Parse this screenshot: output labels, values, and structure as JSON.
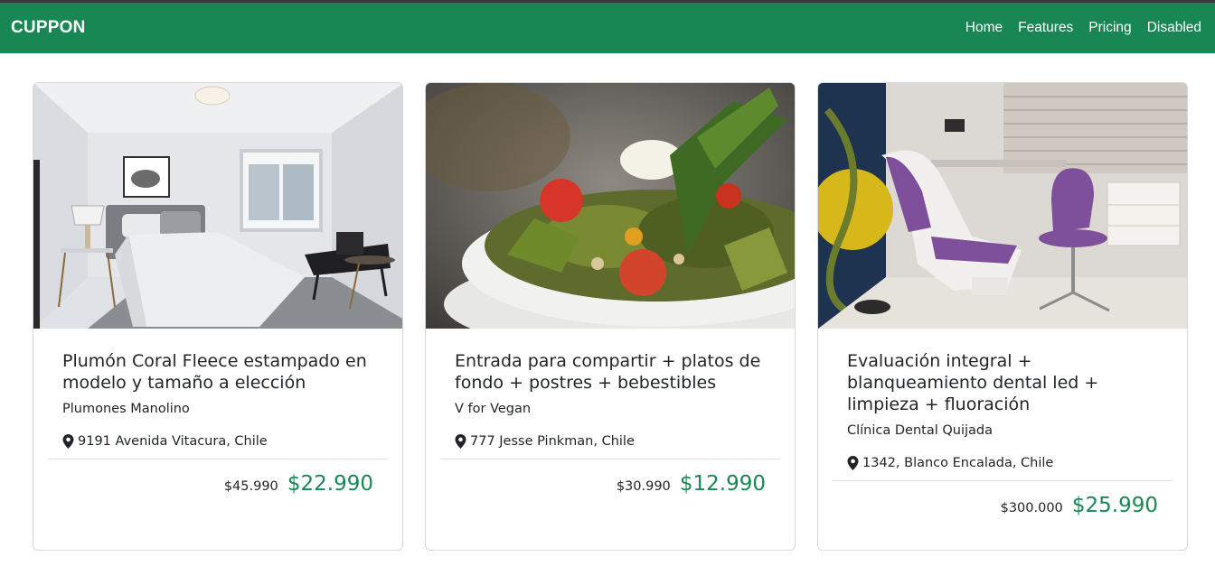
{
  "navbar": {
    "brand": "CUPPON",
    "links": [
      {
        "label": "Home"
      },
      {
        "label": "Features"
      },
      {
        "label": "Pricing"
      },
      {
        "label": "Disabled"
      }
    ]
  },
  "cards": [
    {
      "image": "bedroom photo",
      "title": "Plumón Coral Fleece estampado en modelo y tamaño a elección",
      "merchant": "Plumones Manolino",
      "location": "9191 Avenida Vitacura, Chile",
      "old_price": "$45.990",
      "price": "$22.990"
    },
    {
      "image": "salad bowl photo",
      "title": "Entrada para compartir + platos de fondo + postres + bebestibles",
      "merchant": "V for Vegan",
      "location": "777 Jesse Pinkman, Chile",
      "old_price": "$30.990",
      "price": "$12.990"
    },
    {
      "image": "dental clinic photo",
      "title": "Evaluación integral + blanqueamiento dental led + limpieza + fluoración",
      "merchant": "Clínica Dental Quijada",
      "location": "1342, Blanco Encalada, Chile",
      "old_price": "$300.000",
      "price": "$25.990"
    }
  ],
  "colors": {
    "navbar": "#198754",
    "price": "#198754"
  }
}
